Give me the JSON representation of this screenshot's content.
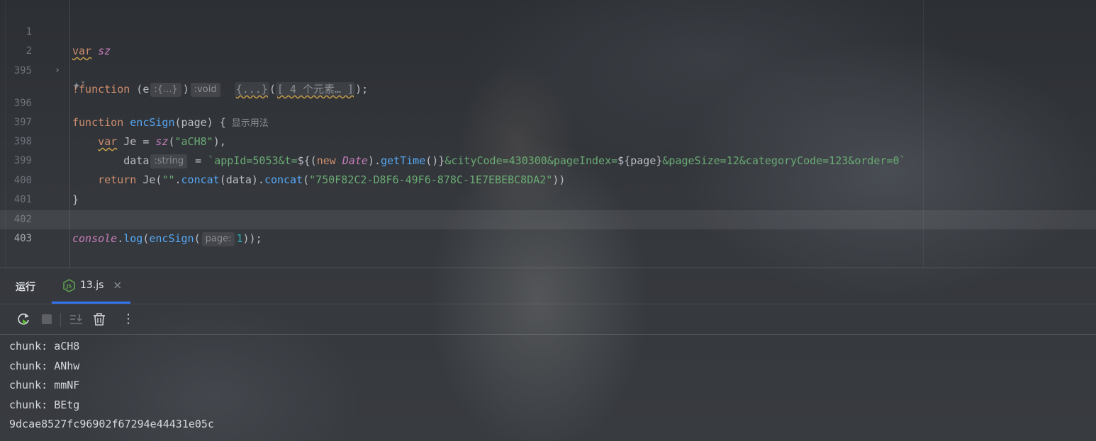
{
  "editor": {
    "line_numbers": [
      "1",
      "2",
      "395",
      "",
      "396",
      "397",
      "398",
      "399",
      "400",
      "401",
      "402",
      "403"
    ],
    "line1": {
      "kw": "var",
      "name": "sz"
    },
    "line2": {
      "prefix": "!function",
      "paren_open": " (e",
      "hint_e": ":{...}",
      "paren_close": ")",
      "hint_ret": ":void",
      "body_fold": "{...}",
      "call_open": "(",
      "args_fold": "[ 4 个元素… ]",
      "call_close": ");"
    },
    "line396": {
      "kw": "function",
      "name": "encSign",
      "params": "(page) {",
      "usages": "显示用法"
    },
    "line397": {
      "kw": "var",
      "var_name": " Je = ",
      "call": "sz",
      "open": "(",
      "arg": "\"aCH8\"",
      "close": "),"
    },
    "line398": {
      "name": "data",
      "hint": ":string",
      "eq": " = ",
      "tpl_a": "`appId=5053&t=",
      "interp_a": "${(",
      "new_kw": "new",
      "date_cls": "Date",
      "dot1": ").",
      "get_time": "getTime",
      "interp_b": "()}",
      "tpl_b": "&cityCode=430300&pageIndex=",
      "interp_c": "${page}",
      "tpl_c": "&pageSize=12&categoryCode=123&order=0`"
    },
    "line399": {
      "kw": "return",
      "a": " Je(",
      "empty_str": "\"\"",
      "dot1": ".",
      "concat1": "concat",
      "b": "(data).",
      "concat2": "concat",
      "c": "(",
      "key": "\"750F82C2-D8F6-49F6-878C-1E7EBEBC8DA2\"",
      "d": "))"
    },
    "line400": "}",
    "line402": {
      "obj": "console",
      "dot": ".",
      "method": "log",
      "open": "(",
      "inner": "encSign",
      "open2": "(",
      "hint": "page:",
      "arg": "1",
      "close": "));"
    }
  },
  "run_panel": {
    "title": "运行",
    "tab": {
      "name": "13.js",
      "close": "×"
    },
    "toolbar": {
      "rerun": "rerun-icon",
      "stop": "stop-icon",
      "scroll_end": "scroll-to-end-icon",
      "clear": "trash-icon",
      "more": "⋮"
    },
    "output": [
      "chunk: aCH8",
      "chunk: ANhw",
      "chunk: mmNF",
      "chunk: BEtg",
      "9dcae8527fc96902f67294e44431e05c"
    ]
  },
  "colors": {
    "keyword": "#cf8e6d",
    "function": "#56a8f5",
    "string": "#6aab73",
    "number": "#2aacb8",
    "global": "#c77dbb",
    "accent": "#3574f0"
  }
}
